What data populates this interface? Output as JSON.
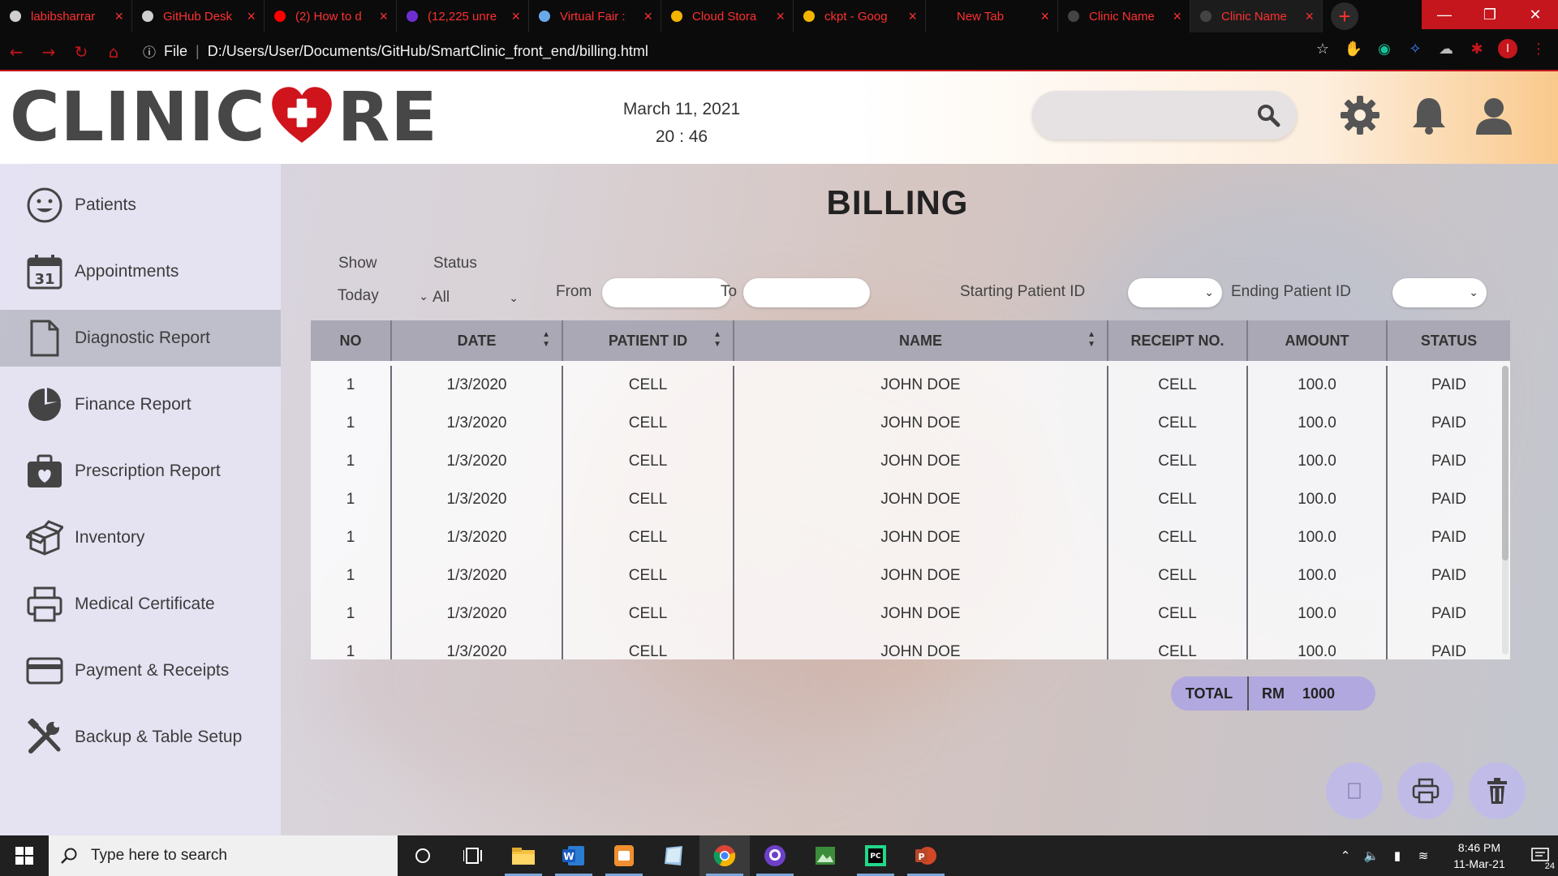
{
  "browser": {
    "tabs": [
      {
        "title": "labibsharrar",
        "icon": "github-icon"
      },
      {
        "title": "GitHub Desk",
        "icon": "github-icon"
      },
      {
        "title": "(2) How to d",
        "icon": "youtube-icon"
      },
      {
        "title": "(12,225 unre",
        "icon": "mail-icon"
      },
      {
        "title": "Virtual Fair :",
        "icon": "image-icon"
      },
      {
        "title": "Cloud Stora",
        "icon": "drive-icon"
      },
      {
        "title": "ckpt - Goog",
        "icon": "drive-icon"
      },
      {
        "title": "New Tab",
        "icon": ""
      },
      {
        "title": "Clinic Name",
        "icon": "page-icon"
      },
      {
        "title": "Clinic Name",
        "icon": "page-icon"
      }
    ],
    "new_tab": "+",
    "address_scheme": "File",
    "address_url": "D:/Users/User/Documents/GitHub/SmartClinic_front_end/billing.html",
    "profile_initial": "I"
  },
  "header": {
    "logo_left": "CLINIC",
    "logo_right": "RE",
    "date": "March 11, 2021",
    "time": "20 : 46",
    "search_placeholder": ""
  },
  "sidebar": {
    "items": [
      {
        "label": "Patients",
        "icon": "smiley-icon"
      },
      {
        "label": "Appointments",
        "icon": "calendar-icon",
        "badge": "31"
      },
      {
        "label": "Diagnostic Report",
        "icon": "document-icon",
        "active": true
      },
      {
        "label": "Finance Report",
        "icon": "pie-chart-icon"
      },
      {
        "label": "Prescription Report",
        "icon": "medkit-icon"
      },
      {
        "label": "Inventory",
        "icon": "box-icon"
      },
      {
        "label": "Medical Certificate",
        "icon": "printer-icon"
      },
      {
        "label": "Payment & Receipts",
        "icon": "credit-card-icon"
      },
      {
        "label": "Backup & Table Setup",
        "icon": "tools-icon"
      }
    ]
  },
  "main": {
    "title": "BILLING",
    "filters": {
      "show_label": "Show",
      "show_value": "Today",
      "status_label": "Status",
      "status_value": "All",
      "from_label": "From",
      "to_label": "To",
      "start_id_label": "Starting Patient ID",
      "end_id_label": "Ending Patient ID"
    },
    "table": {
      "columns": [
        "NO",
        "DATE",
        "PATIENT ID",
        "NAME",
        "RECEIPT NO.",
        "AMOUNT",
        "STATUS"
      ],
      "rows": [
        [
          "1",
          "1/3/2020",
          "CELL",
          "JOHN DOE",
          "CELL",
          "100.0",
          "PAID"
        ],
        [
          "1",
          "1/3/2020",
          "CELL",
          "JOHN DOE",
          "CELL",
          "100.0",
          "PAID"
        ],
        [
          "1",
          "1/3/2020",
          "CELL",
          "JOHN DOE",
          "CELL",
          "100.0",
          "PAID"
        ],
        [
          "1",
          "1/3/2020",
          "CELL",
          "JOHN DOE",
          "CELL",
          "100.0",
          "PAID"
        ],
        [
          "1",
          "1/3/2020",
          "CELL",
          "JOHN DOE",
          "CELL",
          "100.0",
          "PAID"
        ],
        [
          "1",
          "1/3/2020",
          "CELL",
          "JOHN DOE",
          "CELL",
          "100.0",
          "PAID"
        ],
        [
          "1",
          "1/3/2020",
          "CELL",
          "JOHN DOE",
          "CELL",
          "100.0",
          "PAID"
        ],
        [
          "1",
          "1/3/2020",
          "CELL",
          "JOHN DOE",
          "CELL",
          "100.0",
          "PAID"
        ]
      ]
    },
    "total": {
      "label": "TOTAL",
      "currency": "RM",
      "value": "1000"
    }
  },
  "taskbar": {
    "search_placeholder": "Type here to search",
    "time": "8:46 PM",
    "date": "11-Mar-21",
    "notification_count": "24"
  },
  "colors": {
    "accent_red": "#c4161c",
    "sidebar_bg": "#e6e5f5",
    "table_header": "#a9a8b4",
    "total_pill": "#b0a8de"
  }
}
